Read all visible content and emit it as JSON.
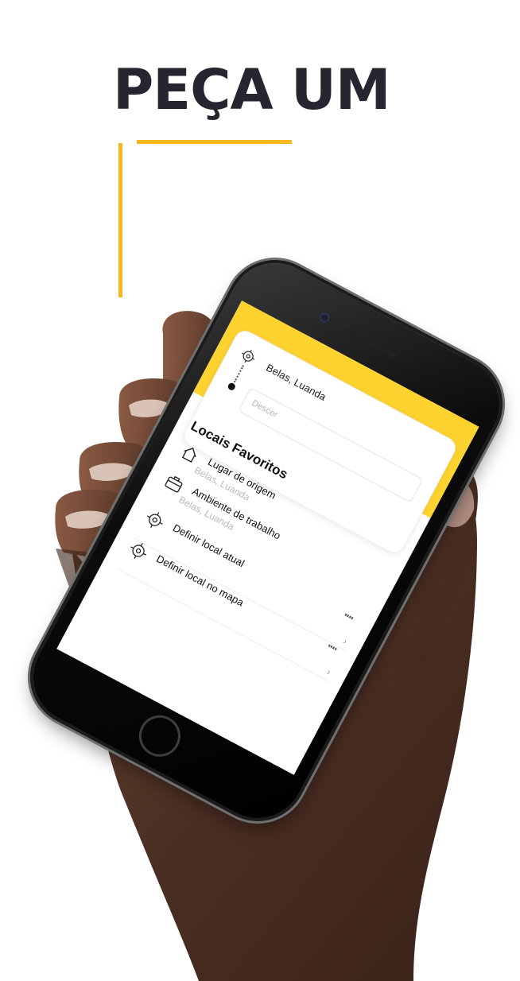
{
  "headline": "PEÇA UM",
  "colors": {
    "accent": "#f8b721",
    "app_yellow": "#fed330",
    "headline": "#262631"
  },
  "app": {
    "origin": {
      "icon": "target-icon",
      "text": "Belas, Luanda"
    },
    "destination": {
      "placeholder": "Descer"
    },
    "favorites_title": "Locais Favoritos",
    "favorites": [
      {
        "icon": "home-icon",
        "label": "Lugar de origem",
        "sublabel": "Belas, Luanda"
      },
      {
        "icon": "briefcase-icon",
        "label": "Ambiente de trabalho",
        "sublabel": "Belas, Luanda"
      }
    ],
    "actions": [
      {
        "icon": "target-icon",
        "label": "Definir local atual",
        "chevron": "›"
      },
      {
        "icon": "target-icon",
        "label": "Definir local no mapa",
        "chevron": "›"
      }
    ]
  }
}
